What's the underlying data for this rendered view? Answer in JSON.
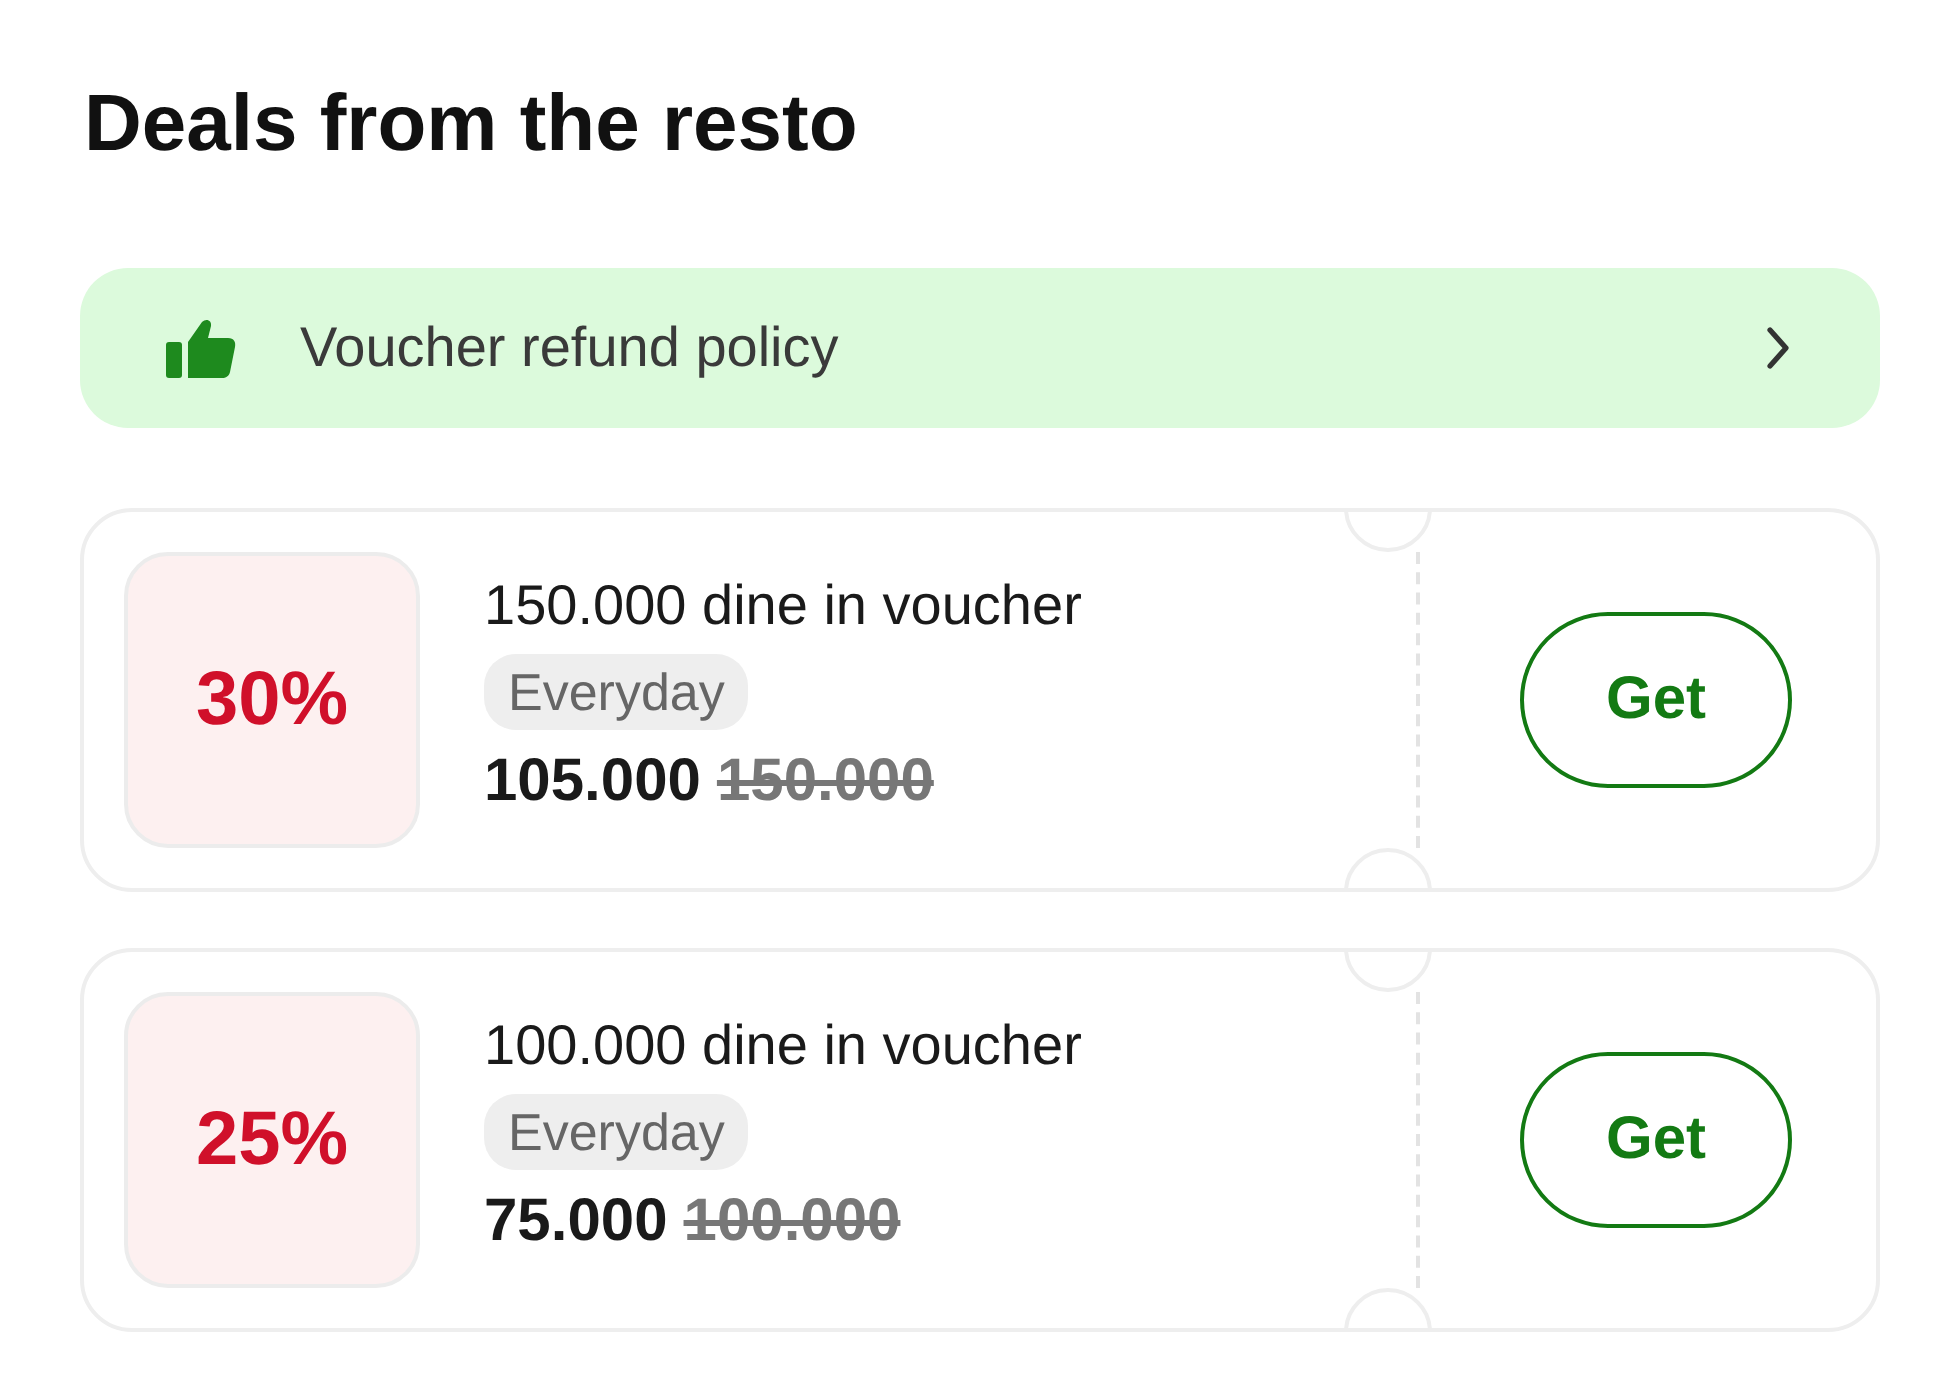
{
  "title": "Deals from the resto",
  "policy_banner": {
    "label": "Voucher refund policy"
  },
  "vouchers": [
    {
      "discount": "30%",
      "name": "150.000 dine in voucher",
      "tag": "Everyday",
      "price": "105.000",
      "original_price": "150.000",
      "button": "Get"
    },
    {
      "discount": "25%",
      "name": "100.000 dine in voucher",
      "tag": "Everyday",
      "price": "75.000",
      "original_price": "100.000",
      "button": "Get"
    }
  ]
}
